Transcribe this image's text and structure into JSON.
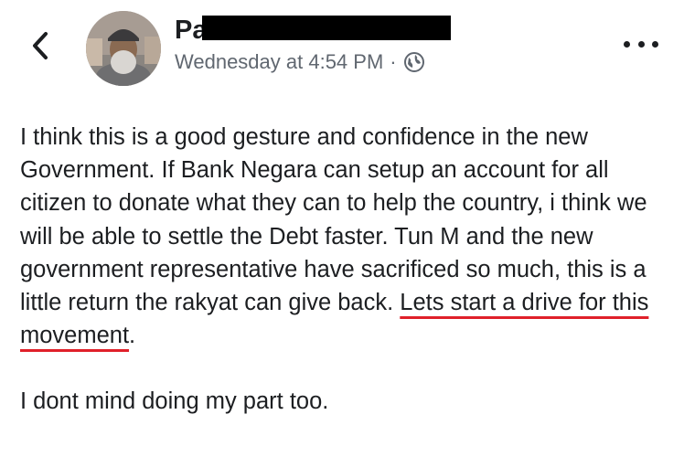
{
  "header": {
    "back_icon": "chevron-left-icon",
    "author_name_visible": "Pa",
    "timestamp": "Wednesday at 4:54 PM",
    "separator": "·",
    "privacy_icon": "globe-icon",
    "more_icon": "more-horizontal-icon"
  },
  "post": {
    "paragraph1_part1": "I think this is a good gesture and confidence in the new Government.  If Bank Negara can setup an account for all citizen to donate what they can to help the country,  i think we will be able to settle the Debt faster. Tun M and the new government representative have sacrificed so much,  this is a little return the rakyat can give back.  ",
    "paragraph1_highlight_a": "Lets start a drive for this",
    "paragraph1_highlight_b": "movement",
    "paragraph1_end": ".",
    "paragraph2": "I dont mind doing my part too."
  },
  "colors": {
    "text": "#1c1e21",
    "meta": "#606770",
    "highlight_underline": "#e0202a"
  }
}
